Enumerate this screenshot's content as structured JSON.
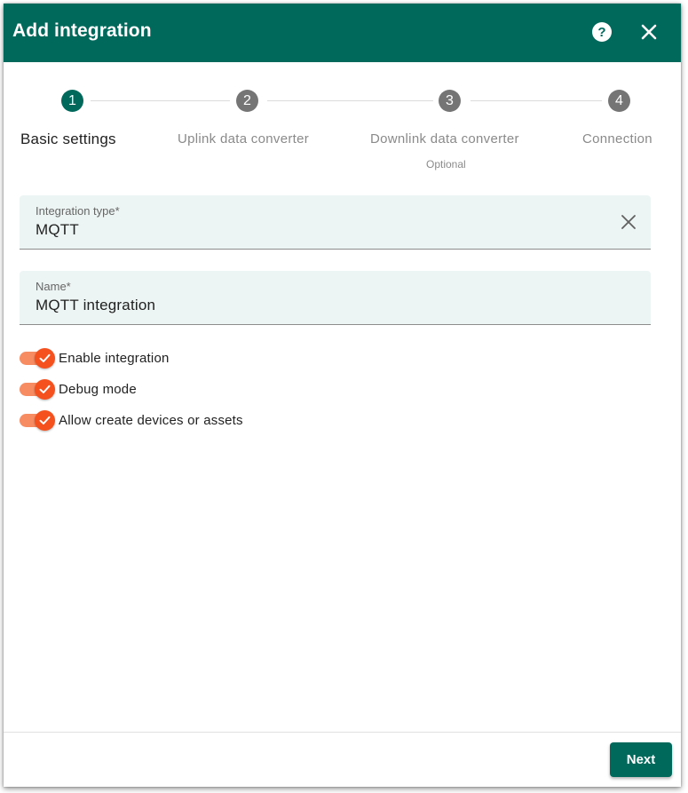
{
  "dialog": {
    "title": "Add integration",
    "help_icon": "help-circle-icon",
    "close_icon": "close-icon"
  },
  "stepper": {
    "steps": [
      {
        "number": "1",
        "label": "Basic settings",
        "sublabel": "",
        "state": "active"
      },
      {
        "number": "2",
        "label": "Uplink data converter",
        "sublabel": "",
        "state": "inactive"
      },
      {
        "number": "3",
        "label": "Downlink data converter",
        "sublabel": "Optional",
        "state": "inactive"
      },
      {
        "number": "4",
        "label": "Connection",
        "sublabel": "",
        "state": "inactive"
      }
    ]
  },
  "form": {
    "integration_type": {
      "label": "Integration type*",
      "value": "MQTT"
    },
    "name": {
      "label": "Name*",
      "value": "MQTT integration"
    },
    "toggles": [
      {
        "label": "Enable integration",
        "checked": true
      },
      {
        "label": "Debug mode",
        "checked": true
      },
      {
        "label": "Allow create devices or assets",
        "checked": true
      }
    ]
  },
  "footer": {
    "next_label": "Next"
  },
  "colors": {
    "primary": "#00695c",
    "accent": "#f4511e",
    "accent_track": "#f78c63",
    "field_bg": "#edf5f4"
  }
}
